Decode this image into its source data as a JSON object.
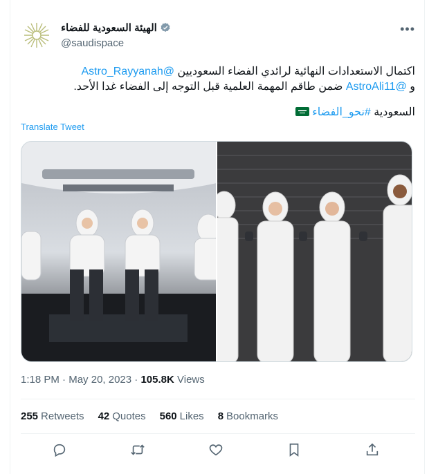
{
  "author": {
    "name": "الهيئة السعودية للفضاء",
    "handle": "@saudispace"
  },
  "tweet": {
    "line1_text": "اكتمال الاستعدادات النهائية لرائدي الفضاء السعوديين",
    "line1_mention": "@Astro_Rayyanah",
    "line2_prefix": "و",
    "line2_mention": "@AstroAli11",
    "line2_text": "ضمن طاقم المهمة العلمية قبل التوجه إلى الفضاء غدا الأحد.",
    "line3_text": "السعودية",
    "line3_hashtag": "#نحو_الفضاء",
    "translate_label": "Translate Tweet"
  },
  "meta": {
    "time": "1:18 PM",
    "date": "May 20, 2023",
    "views_count": "105.8K",
    "views_label": "Views"
  },
  "stats": {
    "retweets_count": "255",
    "retweets_label": "Retweets",
    "quotes_count": "42",
    "quotes_label": "Quotes",
    "likes_count": "560",
    "likes_label": "Likes",
    "bookmarks_count": "8",
    "bookmarks_label": "Bookmarks"
  },
  "icons": {
    "more": "more-icon",
    "verified": "verified-badge-icon",
    "reply": "reply-icon",
    "retweet": "retweet-icon",
    "like": "like-icon",
    "bookmark": "bookmark-icon",
    "share": "share-icon",
    "flag": "saudi-flag-icon"
  },
  "colors": {
    "accent": "#1d9bf0",
    "muted": "#536471",
    "text": "#0f1419",
    "flag_green": "#006c35"
  }
}
